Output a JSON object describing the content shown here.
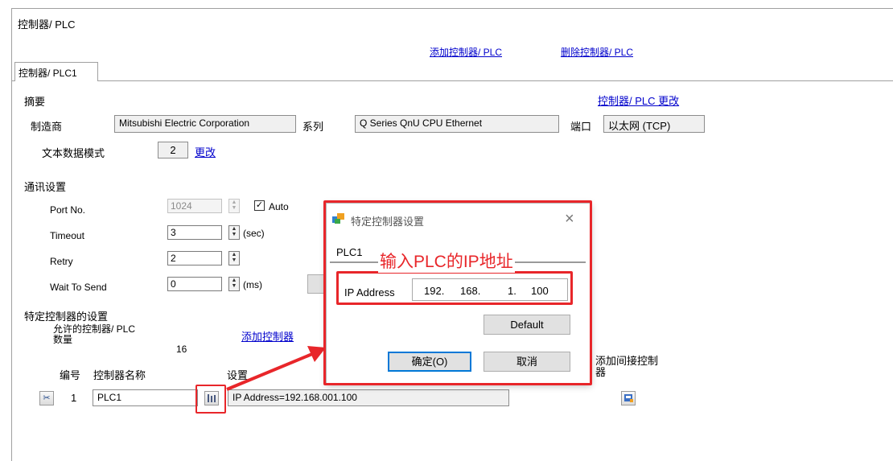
{
  "header": {
    "title": "控制器/ PLC",
    "add_link": "添加控制器/ PLC",
    "delete_link": "删除控制器/ PLC"
  },
  "tab": {
    "label": "控制器/ PLC1"
  },
  "summary": {
    "heading": "摘要",
    "change_link": "控制器/ PLC 更改",
    "maker_label": "制造商",
    "maker_value": "Mitsubishi Electric Corporation",
    "series_label": "系列",
    "series_value": "Q Series QnU CPU Ethernet",
    "port_label": "端口",
    "port_value": "以太网 (TCP)",
    "text_mode_label": "文本数据模式",
    "text_mode_value": "2",
    "text_mode_change": "更改"
  },
  "comm": {
    "heading": "通讯设置",
    "port_no_label": "Port No.",
    "port_no_value": "1024",
    "auto_label": "Auto",
    "auto_checked": true,
    "timeout_label": "Timeout",
    "timeout_value": "3",
    "timeout_unit": "(sec)",
    "retry_label": "Retry",
    "retry_value": "2",
    "wait_label": "Wait To Send",
    "wait_value": "0",
    "wait_unit": "(ms)"
  },
  "specific": {
    "heading": "特定控制器的设置",
    "allowed_label": "允许的控制器/ PLC 数量",
    "allowed_count": "16",
    "add_link": "添加控制器",
    "col_no": "编号",
    "col_name": "控制器名称",
    "col_settings": "设置",
    "row_no": "1",
    "row_name": "PLC1",
    "row_settings": "IP Address=192.168.001.100",
    "indirect_label": "添加间接控制器"
  },
  "dialog": {
    "title": "特定控制器设置",
    "tab": "PLC1",
    "ip_label": "IP Address",
    "ip_parts": [
      "192.",
      "168.",
      "1.",
      "100"
    ],
    "default_button": "Default",
    "ok_button": "确定(O)",
    "cancel_button": "取消"
  },
  "annotation": {
    "text": "输入PLC的IP地址",
    "color": "#e8262a"
  }
}
